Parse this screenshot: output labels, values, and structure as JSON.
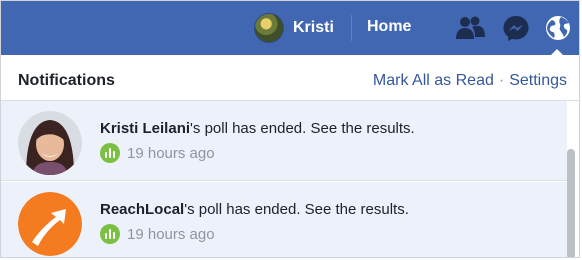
{
  "topbar": {
    "user_name": "Kristi",
    "home_label": "Home",
    "icons": [
      "friends-icon",
      "messenger-icon",
      "globe-icon"
    ],
    "bg_color": "#4267b2"
  },
  "notifications": {
    "title": "Notifications",
    "mark_all_read": "Mark All as Read",
    "separator": "·",
    "settings": "Settings",
    "items": [
      {
        "actor": "Kristi Leilani",
        "text": "'s poll has ended. See the results.",
        "time": "19 hours ago",
        "icon": "poll-icon"
      },
      {
        "actor": "ReachLocal",
        "text": "'s poll has ended. See the results.",
        "time": "19 hours ago",
        "icon": "poll-icon"
      }
    ]
  },
  "colors": {
    "unread_row_bg": "#edf2fa",
    "link": "#365899",
    "poll_green": "#7bc043",
    "reachlocal_orange": "#f47b20"
  }
}
